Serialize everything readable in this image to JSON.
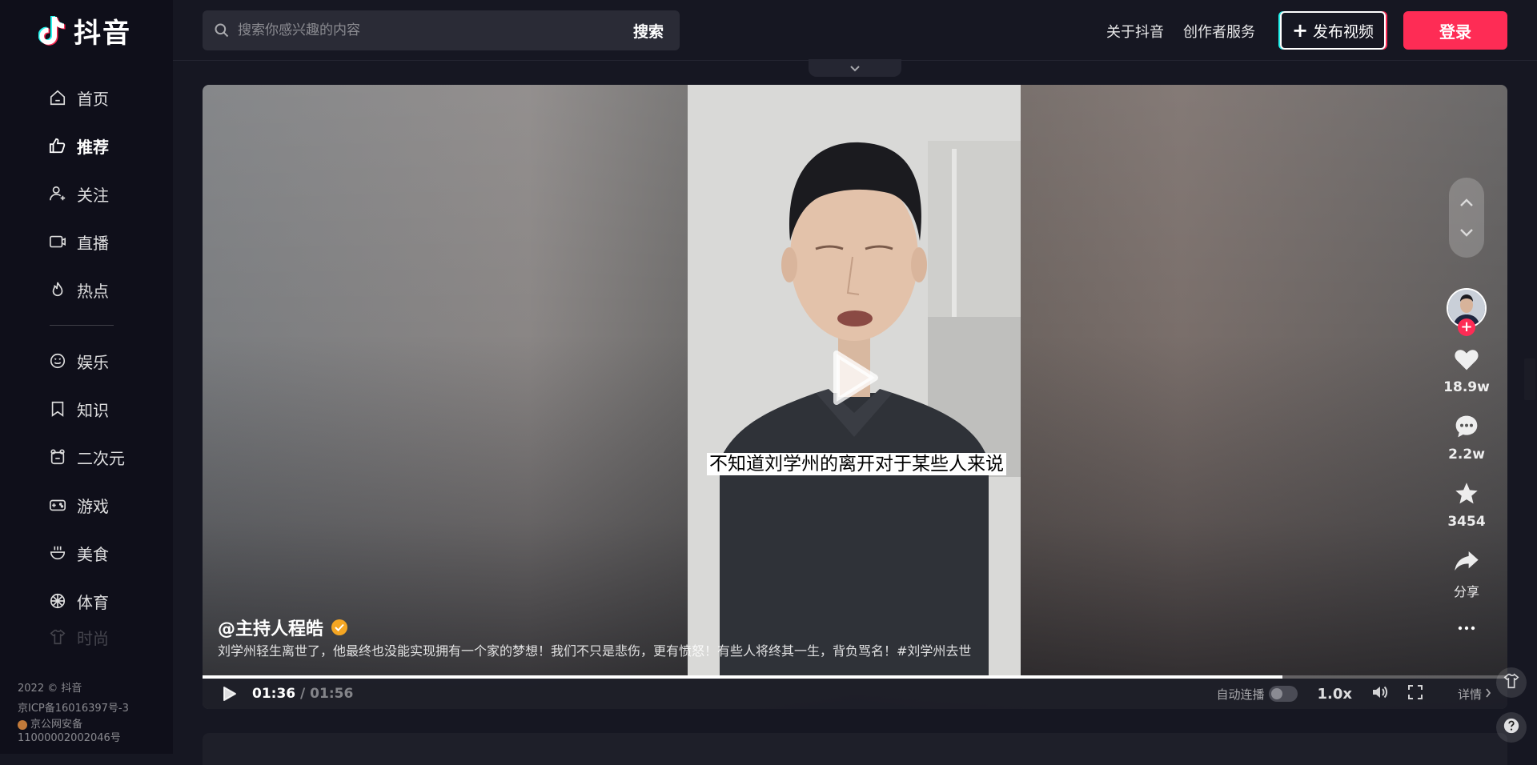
{
  "brand": {
    "name": "抖音"
  },
  "sidebar": {
    "items": [
      {
        "label": "首页",
        "icon": "home-icon",
        "active": false
      },
      {
        "label": "推荐",
        "icon": "thumbs-up-icon",
        "active": true
      },
      {
        "label": "关注",
        "icon": "user-plus-icon",
        "active": false
      },
      {
        "label": "直播",
        "icon": "tv-icon",
        "active": false
      },
      {
        "label": "热点",
        "icon": "flame-icon",
        "active": false
      }
    ],
    "categories": [
      {
        "label": "娱乐",
        "icon": "smile-icon"
      },
      {
        "label": "知识",
        "icon": "bookmark-icon"
      },
      {
        "label": "二次元",
        "icon": "bear-icon"
      },
      {
        "label": "游戏",
        "icon": "gamepad-icon"
      },
      {
        "label": "美食",
        "icon": "bowl-icon"
      },
      {
        "label": "体育",
        "icon": "ball-icon"
      },
      {
        "label": "时尚",
        "icon": "shirt-icon"
      }
    ],
    "footer": {
      "copyright": "2022 © 抖音",
      "icp": "京ICP备16016397号-3",
      "police": "京公网安备",
      "police_no": "11000002002046号"
    }
  },
  "header": {
    "search_placeholder": "搜索你感兴趣的内容",
    "search_button": "搜索",
    "links": [
      "关于抖音",
      "创作者服务"
    ],
    "publish_button": "发布视频",
    "login_button": "登录"
  },
  "video": {
    "subtitle": "不知道刘学州的离开对于某些人来说",
    "author": "@主持人程皓",
    "description": "刘学州轻生离世了，他最终也没能实现拥有一个家的梦想！我们不只是悲伤，更有愤怒！有些人将终其一生，背负骂名！#刘学州去世",
    "current_time": "01:36",
    "separator": " / ",
    "duration": "01:56",
    "progress_fraction": 0.8276,
    "autoplay_label": "自动连播",
    "speed": "1.0x",
    "details_label": "详情",
    "likes": "18.9w",
    "comments": "2.2w",
    "favorites": "3454",
    "share_label": "分享"
  },
  "colors": {
    "accent": "#fe2c55",
    "cyan": "#25f4ee",
    "bg": "#161722",
    "sidebar": "#0f0f1a",
    "verified": "#f5a623"
  }
}
